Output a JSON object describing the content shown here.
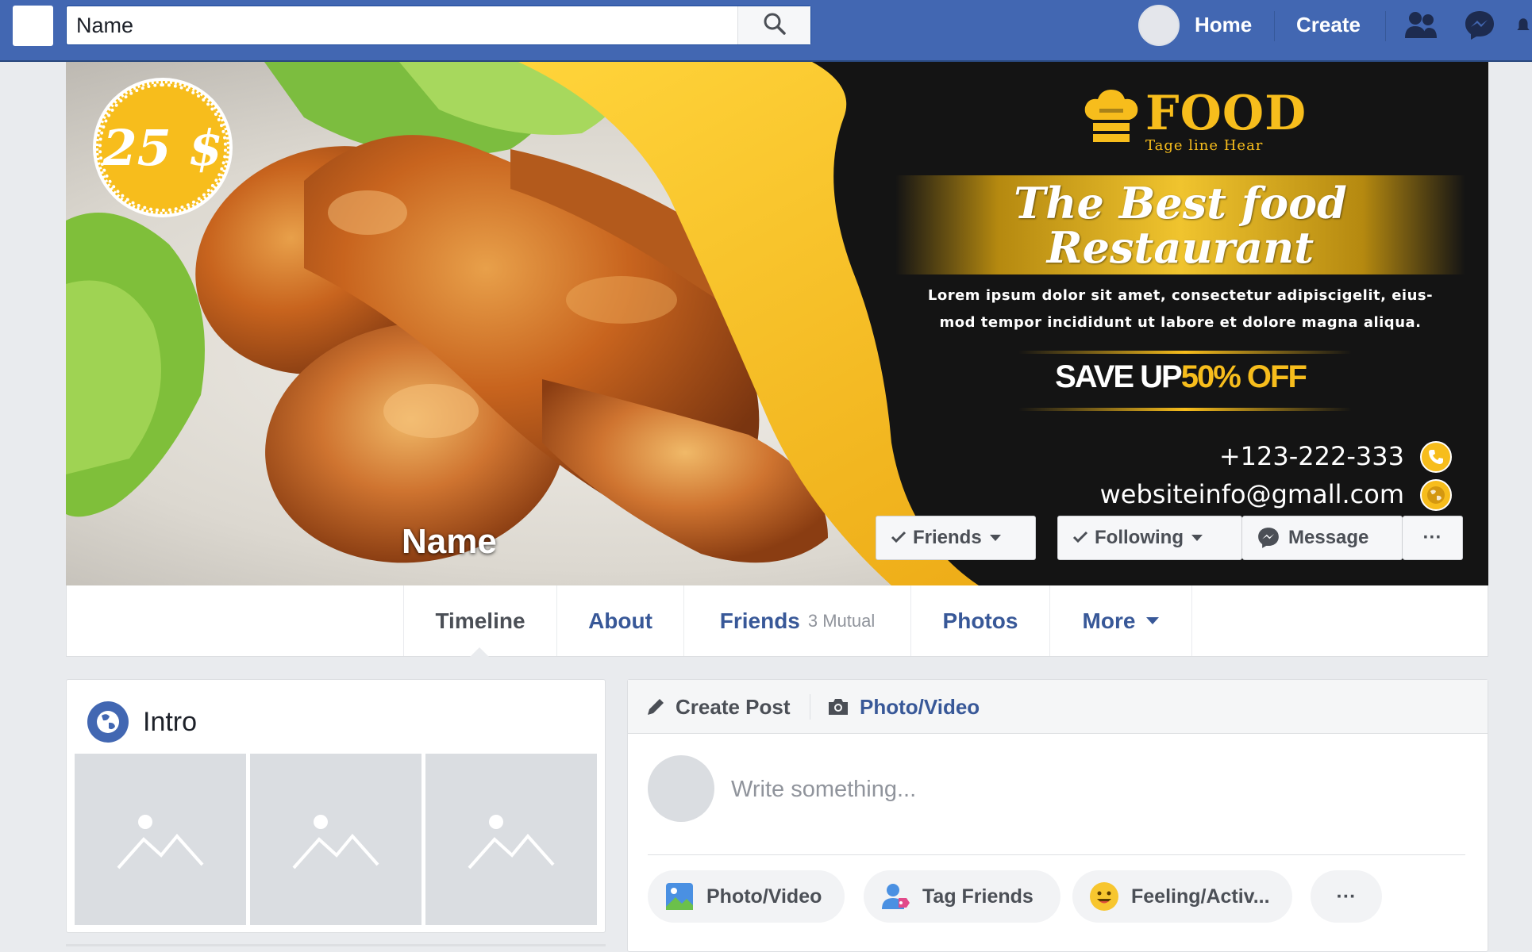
{
  "search": {
    "value": "Name",
    "placeholder": "Name"
  },
  "nav": {
    "home": "Home",
    "create": "Create"
  },
  "cover": {
    "price": "25 $",
    "brand_name": "FOOD",
    "brand_tagline": "Tage line Hear",
    "headline_line1": "The Best food",
    "headline_line2": "Restaurant",
    "lorem_line1": "Lorem ipsum dolor sit amet, consectetur adipiscigelit,  eius-",
    "lorem_line2": "mod tempor incididunt ut labore et dolore magna aliqua.",
    "save_white": "SAVE UP",
    "save_yellow": "50% OFF",
    "phone": "+123-222-333",
    "email": "websiteinfo@gmall.com",
    "profile_name": "Name",
    "accent": "#f7bd1c"
  },
  "cover_buttons": {
    "friends": "Friends",
    "following": "Following",
    "message": "Message",
    "more": "···"
  },
  "tabs": {
    "timeline": "Timeline",
    "about": "About",
    "friends": "Friends",
    "friends_mutual": "3 Mutual",
    "photos": "Photos",
    "more": "More"
  },
  "intro": {
    "title": "Intro"
  },
  "post": {
    "create_post": "Create Post",
    "photo_video_tab": "Photo/Video",
    "placeholder": "Write something...",
    "actions": {
      "photo_video": "Photo/Video",
      "tag_friends": "Tag Friends",
      "feeling": "Feeling/Activ...",
      "more": "···"
    }
  },
  "colors": {
    "brand_blue": "#4267b2",
    "link_blue": "#385898",
    "background": "#e9ebee"
  }
}
